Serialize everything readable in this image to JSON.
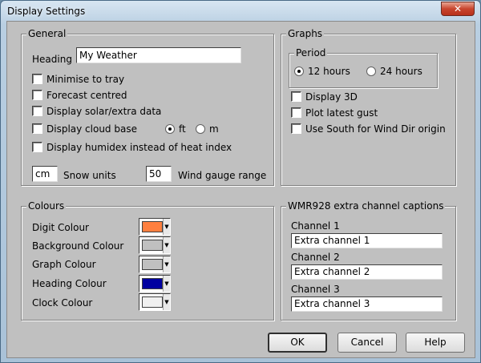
{
  "window": {
    "title": "Display Settings",
    "close_glyph": "✕"
  },
  "general": {
    "legend": "General",
    "heading_label": "Heading",
    "heading_value": "My Weather",
    "minimise": "Minimise to tray",
    "forecast": "Forecast centred",
    "solar": "Display solar/extra data",
    "cloud": "Display cloud base",
    "cloud_ft": "ft",
    "cloud_m": "m",
    "humidex": "Display humidex instead of heat index",
    "snow_value": "cm",
    "snow_label": "Snow units",
    "wind_value": "50",
    "wind_label": "Wind gauge range"
  },
  "graphs": {
    "legend": "Graphs",
    "period_legend": "Period",
    "p12": "12 hours",
    "p24": "24 hours",
    "d3d": "Display 3D",
    "gust": "Plot latest gust",
    "south": "Use South for Wind Dir origin"
  },
  "colours": {
    "legend": "Colours",
    "digit": "Digit Colour",
    "background": "Background Colour",
    "graph": "Graph Colour",
    "heading": "Heading Colour",
    "clock": "Clock Colour",
    "swatches": {
      "digit": "#ff8040",
      "background": "#c0c0c0",
      "graph": "#c0c0c0",
      "heading": "#0000a0",
      "clock": "#f0f0f0"
    }
  },
  "wmr": {
    "legend": "WMR928 extra channel captions",
    "ch1_label": "Channel 1",
    "ch1_value": "Extra channel 1",
    "ch2_label": "Channel 2",
    "ch2_value": "Extra channel 2",
    "ch3_label": "Channel 3",
    "ch3_value": "Extra channel 3"
  },
  "buttons": {
    "ok": "OK",
    "cancel": "Cancel",
    "help": "Help"
  }
}
